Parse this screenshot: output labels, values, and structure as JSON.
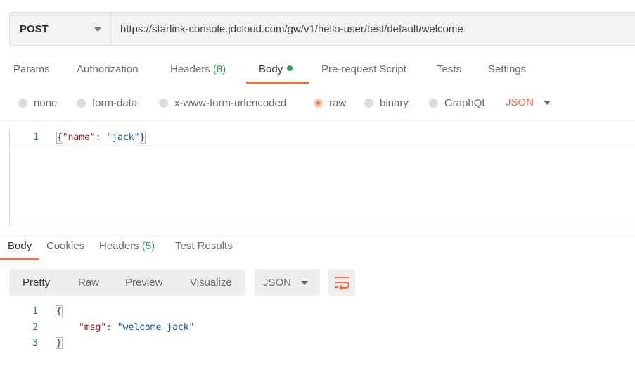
{
  "request": {
    "method": "POST",
    "url": "https://starlink-console.jdcloud.com/gw/v1/hello-user/test/default/welcome",
    "tabs": {
      "params": "Params",
      "authorization": "Authorization",
      "headers": "Headers",
      "headers_count": "(8)",
      "body": "Body",
      "prerequest": "Pre-request Script",
      "tests": "Tests",
      "settings": "Settings"
    },
    "body_modes": {
      "none": "none",
      "form_data": "form-data",
      "urlencoded": "x-www-form-urlencoded",
      "raw": "raw",
      "binary": "binary",
      "graphql": "GraphQL"
    },
    "selected_mode": "raw",
    "content_type": "JSON",
    "editor": {
      "line1_num": "1",
      "open": "{",
      "key": "\"name\"",
      "colon": ": ",
      "value": "\"jack\"",
      "close": "}"
    }
  },
  "response": {
    "tabs": {
      "body": "Body",
      "cookies": "Cookies",
      "headers": "Headers",
      "headers_count": "(5)",
      "test_results": "Test Results"
    },
    "views": {
      "pretty": "Pretty",
      "raw": "Raw",
      "preview": "Preview",
      "visualize": "Visualize"
    },
    "format": "JSON",
    "lines": {
      "n1": "1",
      "n2": "2",
      "n3": "3",
      "open": "{",
      "key": "\"msg\"",
      "colon": ": ",
      "value": "\"welcome jack\"",
      "close": "}"
    }
  },
  "colors": {
    "accent": "#f26b3a",
    "green": "#26a65b"
  }
}
